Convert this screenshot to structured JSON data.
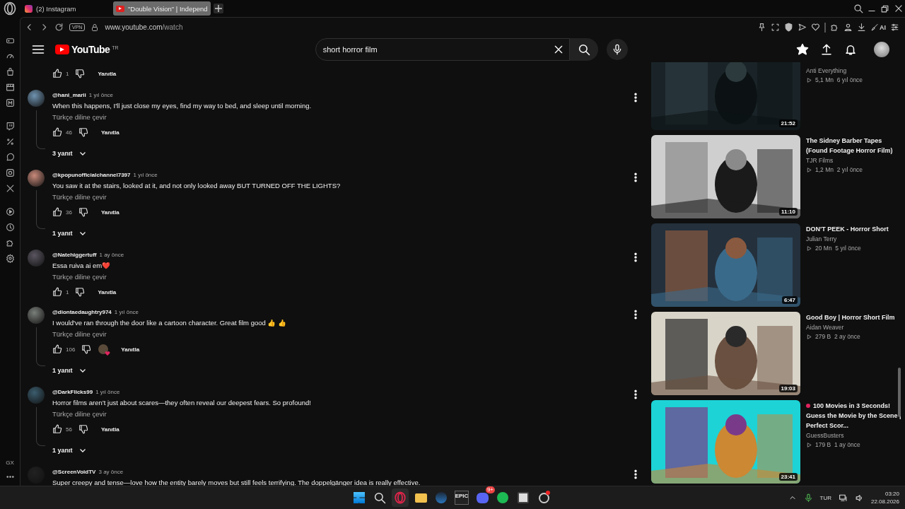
{
  "browser": {
    "tabs": [
      {
        "title": "(2) Instagram",
        "kind": "instagram",
        "selected": false
      },
      {
        "title": "\"Double Vision\" | Independ",
        "kind": "youtube",
        "selected": true
      }
    ],
    "vpn": "VPN",
    "url_host": "www.youtube.com",
    "url_path": "/watch",
    "ai_label": "AI",
    "sidebar_label": "GX"
  },
  "youtube": {
    "logo": "YouTube",
    "region": "TR",
    "search": {
      "value": "short horror film"
    }
  },
  "previous_reply": {
    "likes": "1",
    "reply": "Yanıtla"
  },
  "comments": [
    {
      "author": "@hani_marii",
      "time": "1 yıl önce",
      "text": "When this happens, I'll just close my eyes, find my way to bed, and sleep until morning.",
      "translate": "Türkçe diline çevir",
      "likes": "46",
      "reply": "Yanıtla",
      "hearted": false,
      "replies": "3 yanıt"
    },
    {
      "author": "@kpopunofficialchannel7397",
      "time": "1 yıl önce",
      "text": "You saw it at the stairs, looked at it, and not only looked away BUT TURNED OFF THE LIGHTS?",
      "translate": "Türkçe diline çevir",
      "likes": "36",
      "reply": "Yanıtla",
      "hearted": false,
      "replies": "1 yanıt"
    },
    {
      "author": "@Natehiggertuff",
      "time": "1 ay önce",
      "text": "Essa ruiva ai em❤️",
      "translate": "Türkçe diline çevir",
      "likes": "1",
      "reply": "Yanıtla",
      "hearted": false
    },
    {
      "author": "@diontaedaughtry974",
      "time": "1 yıl önce",
      "text": "I would've ran through the door like a cartoon character. Great film good 👍 👍",
      "translate": "Türkçe diline çevir",
      "likes": "106",
      "reply": "Yanıtla",
      "hearted": true,
      "replies": "1 yanıt"
    },
    {
      "author": "@DarkFlicks99",
      "time": "1 yıl önce",
      "text": "Horror films aren’t just about scares—they often reveal our deepest fears. So profound!",
      "translate": "Türkçe diline çevir",
      "likes": "56",
      "reply": "Yanıtla",
      "hearted": false,
      "replies": "1 yanıt"
    },
    {
      "author": "@ScreenVoidTV",
      "time": "3 ay önce",
      "text": "Super creepy and tense—love how the entity barely moves but still feels terrifying. The doppelgänger idea is really effective."
    }
  ],
  "recommendations": [
    {
      "channel": "Anti Everything",
      "views": "5,1 Mn",
      "age": "6 yıl önce",
      "duration": "21:52"
    },
    {
      "title": "The Sidney Barber Tapes (Found Footage Horror Film)",
      "channel": "TJR Films",
      "views": "1,2 Mn",
      "age": "2 yıl önce",
      "duration": "11:10"
    },
    {
      "title": "DON'T PEEK -  Horror Short",
      "channel": "Julian Terry",
      "views": "20 Mn",
      "age": "5 yıl önce",
      "duration": "6:47"
    },
    {
      "title": "Good Boy | Horror Short Film",
      "channel": "Aidan Weaver",
      "views": "279 B",
      "age": "2 ay önce",
      "duration": "19:03"
    },
    {
      "title": "100 Movies in 3 Seconds! Guess the Movie by the Scene | Perfect Scor...",
      "live_mark": true,
      "channel": "GuessBusters",
      "views": "179 B",
      "age": "1 ay önce",
      "duration": "23:41"
    }
  ],
  "taskbar": {
    "epic_label": "EPIC",
    "discord_badge": "9+",
    "language": "TUR",
    "time": "03:20",
    "date": "22.08.2026"
  }
}
